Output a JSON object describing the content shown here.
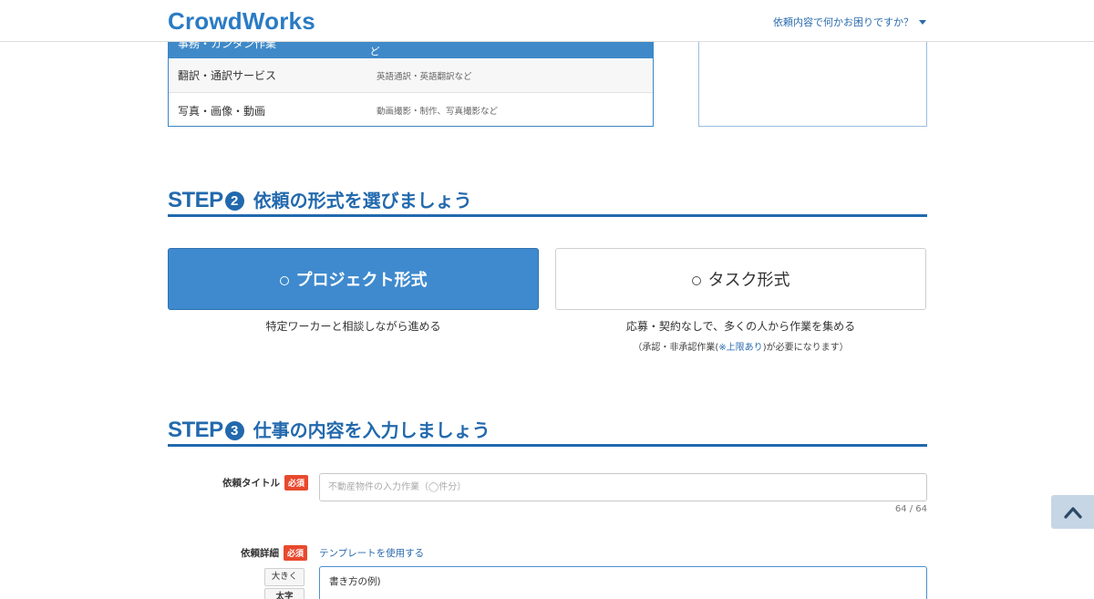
{
  "header": {
    "logo": "CrowdWorks",
    "help_label": "依頼内容で何かお困りですか？"
  },
  "categories": {
    "rows": [
      {
        "name": "事務・カンタン作業",
        "desc": "質問・アンケート、データ入力、テープ起こし・文字起こし など",
        "selected": true
      },
      {
        "name": "翻訳・通訳サービス",
        "desc": "英語通訳・英語翻訳など",
        "selected": false
      },
      {
        "name": "写真・画像・動画",
        "desc": "動画撮影・制作、写真撮影など",
        "selected": false
      }
    ]
  },
  "step2": {
    "prefix": "STEP",
    "number": "2",
    "title": "依頼の形式を選びましょう"
  },
  "options": {
    "project": {
      "label": "プロジェクト形式",
      "desc": "特定ワーカーと相談しながら進める",
      "selected": true
    },
    "task": {
      "label": "タスク形式",
      "desc": "応募・契約なしで、多くの人から作業を集める",
      "note_before": "（承認・非承認作業(",
      "note_link": "※上限あり",
      "note_after": ")が必要になります）",
      "selected": false
    }
  },
  "step3": {
    "prefix": "STEP",
    "number": "3",
    "title": "仕事の内容を入力しましょう"
  },
  "form": {
    "title_label": "依頼タイトル",
    "required_badge": "必須",
    "title_placeholder": "不動産物件の入力作業（◯件分）",
    "counter": "64 / 64",
    "detail_label": "依頼詳細",
    "template_link": "テンプレートを使用する",
    "format_large": "大きく",
    "format_bold": "太字",
    "detail_value": "書き方の例)"
  },
  "colors": {
    "brand": "#2a7bc4",
    "step_blue": "#2269ad",
    "selected_blue": "#3f8ace",
    "required_red": "#e8492e"
  },
  "icons": {
    "back_to_top": "chevron-up-icon",
    "dropdown": "caret-down-icon"
  }
}
